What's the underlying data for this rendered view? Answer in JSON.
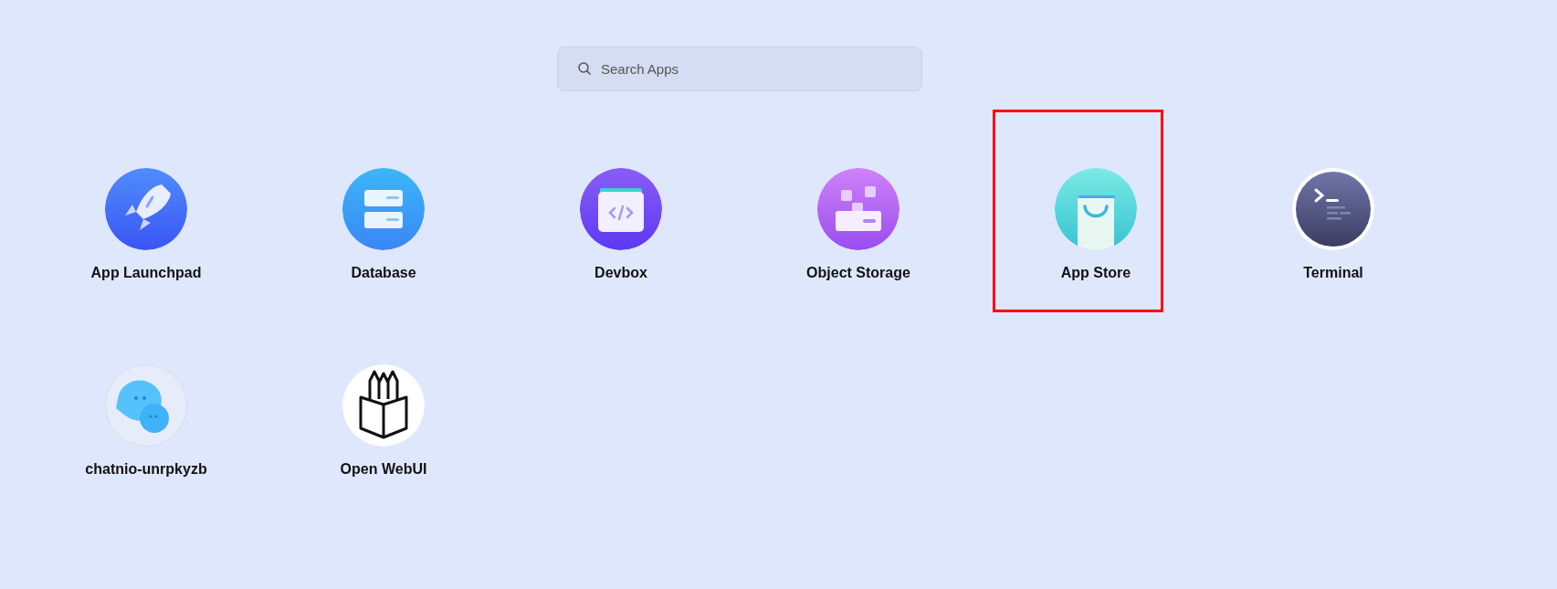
{
  "search": {
    "placeholder": "Search Apps"
  },
  "apps": [
    {
      "name": "App Launchpad",
      "kind": "rocket",
      "highlighted": false
    },
    {
      "name": "Database",
      "kind": "database",
      "highlighted": false
    },
    {
      "name": "Devbox",
      "kind": "devbox",
      "highlighted": false
    },
    {
      "name": "Object Storage",
      "kind": "storage",
      "highlighted": false
    },
    {
      "name": "App Store",
      "kind": "store",
      "highlighted": true
    },
    {
      "name": "Terminal",
      "kind": "terminal",
      "highlighted": false
    },
    {
      "name": "chatnio-unrpkyzb",
      "kind": "chat",
      "highlighted": false
    },
    {
      "name": "Open WebUI",
      "kind": "pencils",
      "highlighted": false
    }
  ]
}
